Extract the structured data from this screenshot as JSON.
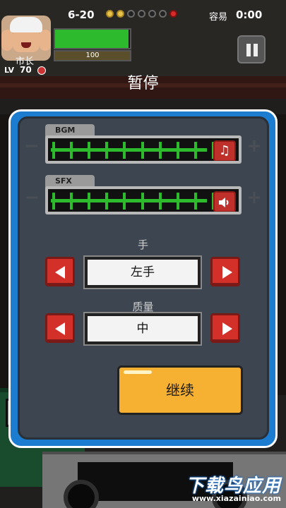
{
  "hud": {
    "stage": "6-20",
    "stage_dots": [
      "done",
      "done",
      "empty",
      "empty",
      "empty",
      "empty",
      "boss"
    ],
    "difficulty": "容易",
    "timer": "0:00",
    "role": "市长",
    "level_label": "LV",
    "level": "70",
    "hp_fraction": 0.98,
    "xp_text": "100"
  },
  "title": "暂停",
  "audio": {
    "bgm": {
      "label": "BGM",
      "level": 0.98,
      "icon": "music-note-icon"
    },
    "sfx": {
      "label": "SFX",
      "level": 0.98,
      "icon": "speaker-icon"
    }
  },
  "hand": {
    "label": "手",
    "value": "左手"
  },
  "quality": {
    "label": "质量",
    "value": "中"
  },
  "continue_label": "继续",
  "watermark": {
    "main": "下载鸟应用",
    "url": "www.xiazainiao.com"
  },
  "colors": {
    "panel_border": "#1b7cd0",
    "slider_green": "#2dbb2d",
    "button_red": "#d3302a",
    "continue_yellow": "#f6b032"
  }
}
